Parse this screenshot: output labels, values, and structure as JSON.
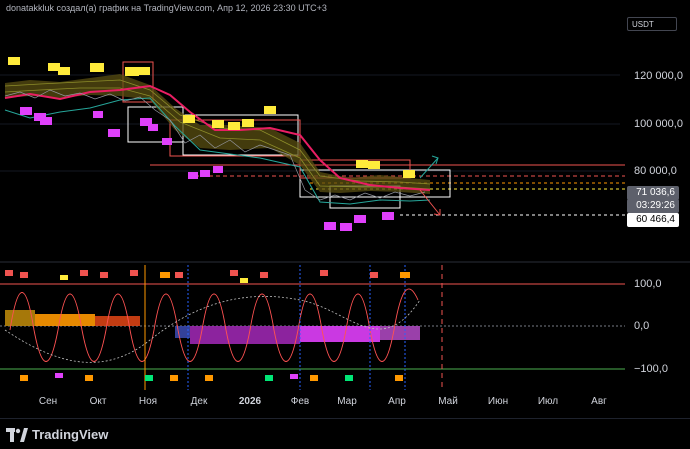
{
  "header": {
    "attribution": "donatakkluk создал(а) график на TradingView.com, Апр 12, 2026 23:30 UTC+3"
  },
  "scale": {
    "currency": "USDT"
  },
  "price_axis": {
    "labels": [
      "120 000,0",
      "100 000,0",
      "80 000,0"
    ]
  },
  "badges": {
    "last_price": "71 036,6",
    "countdown": "03:29:26",
    "level": "60 466,4"
  },
  "oscillator_axis": {
    "labels": [
      "100,0",
      "0,0",
      "−100,0"
    ]
  },
  "time_axis": {
    "labels": [
      "Сен",
      "Окт",
      "Ноя",
      "Дек",
      "2026",
      "Фев",
      "Мар",
      "Апр",
      "Май",
      "Июн",
      "Июл",
      "Авг"
    ]
  },
  "footer": {
    "brand": "TradingView"
  },
  "colors": {
    "background": "#000000",
    "price_line": "#ef5350",
    "accent_yellow": "#ffeb3b",
    "accent_magenta": "#e040fb",
    "osc_line": "#ff5252"
  }
}
